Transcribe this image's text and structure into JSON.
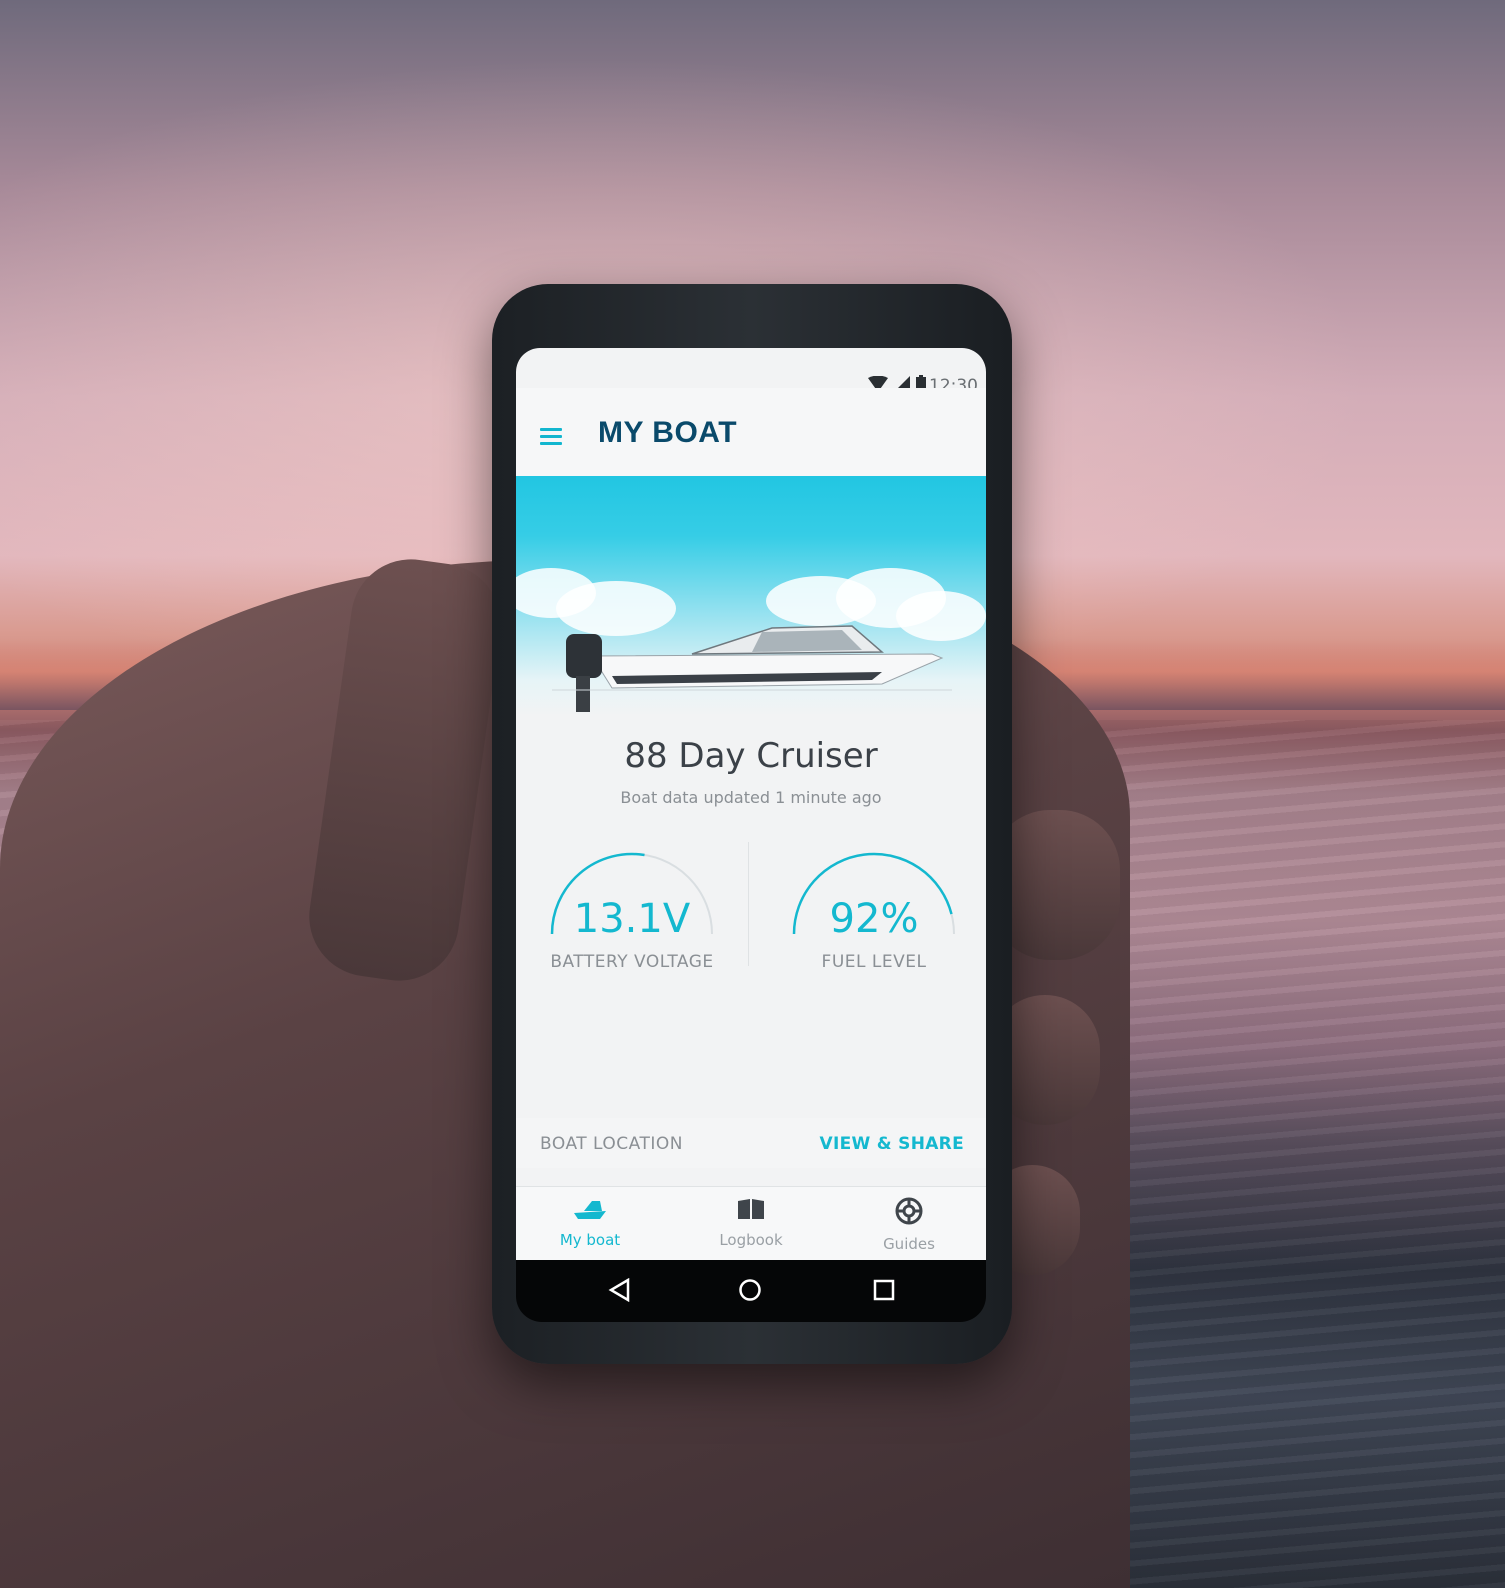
{
  "status_bar": {
    "time": "12:30",
    "icons": [
      "wifi-icon",
      "signal-icon",
      "battery-icon"
    ]
  },
  "app_bar": {
    "title": "MY BOAT",
    "menu_icon": "menu-icon"
  },
  "boat": {
    "name": "88 Day Cruiser",
    "updated": "Boat data updated 1 minute ago"
  },
  "gauges": [
    {
      "value": "13.1V",
      "label": "BATTERY VOLTAGE",
      "fraction": 0.55
    },
    {
      "value": "92%",
      "label": "FUEL LEVEL",
      "fraction": 0.92
    }
  ],
  "location": {
    "label": "BOAT LOCATION",
    "action": "VIEW & SHARE"
  },
  "bottom_nav": [
    {
      "label": "My boat",
      "icon": "boat-icon",
      "active": true
    },
    {
      "label": "Logbook",
      "icon": "book-icon",
      "active": false
    },
    {
      "label": "Guides",
      "icon": "lifebuoy-icon",
      "active": false
    }
  ],
  "system_nav": [
    "back-icon",
    "home-icon",
    "recents-icon"
  ],
  "colors": {
    "accent": "#14b8cf",
    "title": "#0a4a6b",
    "hero_top": "#22c6e2"
  }
}
